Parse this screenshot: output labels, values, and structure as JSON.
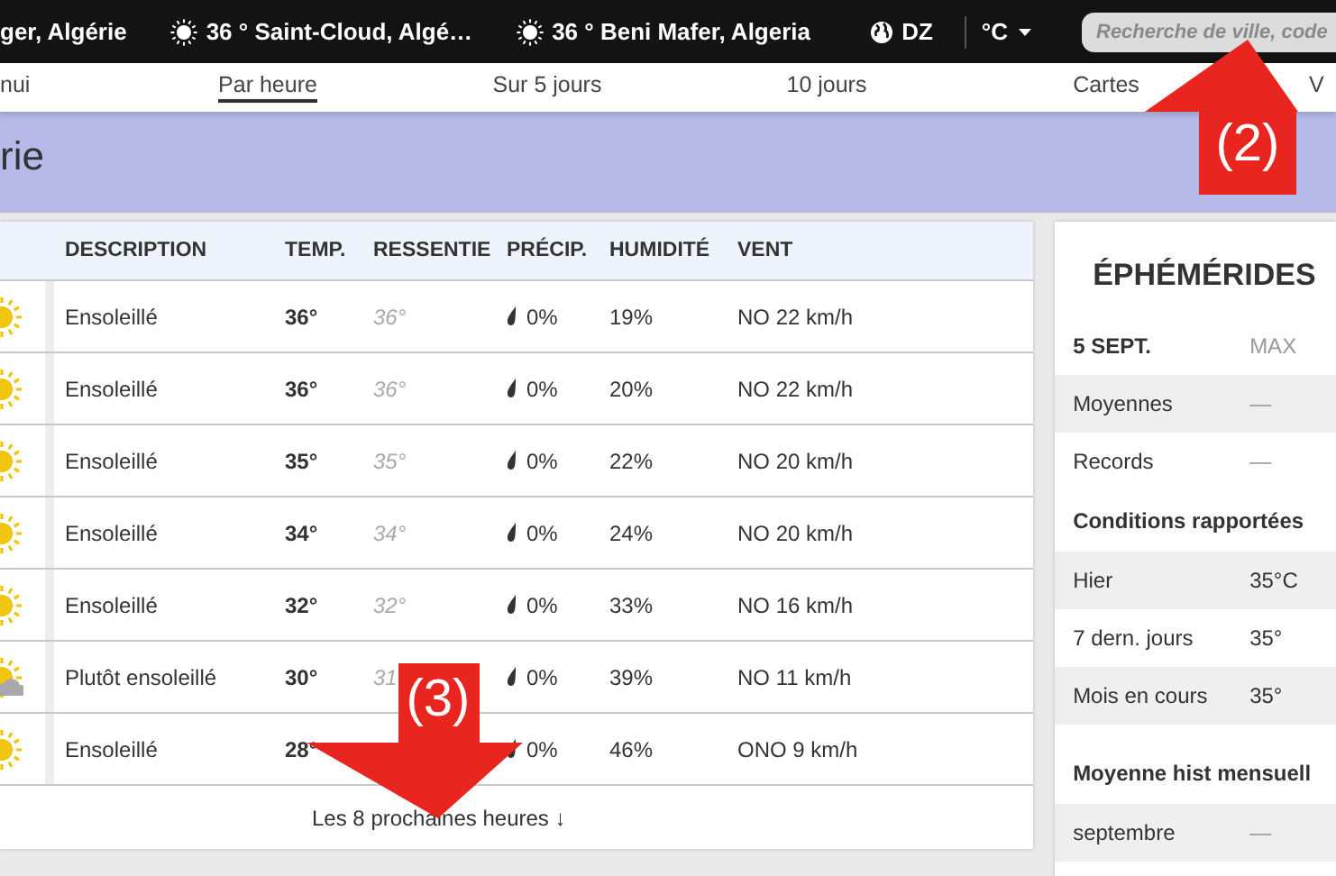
{
  "top_bar": {
    "locations": [
      {
        "kind": "plain",
        "label": "ger, Algérie"
      },
      {
        "kind": "sunny",
        "label": "36 ° Saint-Cloud, Algé…"
      },
      {
        "kind": "sunny",
        "label": "36 ° Beni Mafer, Algeria"
      }
    ],
    "country": "DZ",
    "unit": "°C",
    "search": {
      "placeholder": "Recherche de ville, code"
    }
  },
  "nav_tabs": [
    {
      "label": "nui",
      "selected": false
    },
    {
      "label": "Par heure",
      "selected": true
    },
    {
      "label": "Sur 5 jours",
      "selected": false
    },
    {
      "label": "10 jours",
      "selected": false
    },
    {
      "label": "Cartes",
      "selected": false
    },
    {
      "label": "V",
      "selected": false
    }
  ],
  "banner": {
    "title": "rie"
  },
  "hourly": {
    "columns": [
      "DESCRIPTION",
      "TEMP.",
      "RESSENTIE",
      "PRÉCIP.",
      "HUMIDITÉ",
      "VENT"
    ],
    "rows": [
      {
        "kind": "sunny",
        "description": "Ensoleillé",
        "temp": "36°",
        "feels_like": "36°",
        "precip": "0%",
        "humidity": "19%",
        "wind": "NO 22 km/h"
      },
      {
        "kind": "sunny",
        "description": "Ensoleillé",
        "temp": "36°",
        "feels_like": "36°",
        "precip": "0%",
        "humidity": "20%",
        "wind": "NO 22 km/h"
      },
      {
        "kind": "sunny",
        "description": "Ensoleillé",
        "temp": "35°",
        "feels_like": "35°",
        "precip": "0%",
        "humidity": "22%",
        "wind": "NO 20 km/h"
      },
      {
        "kind": "sunny",
        "description": "Ensoleillé",
        "temp": "34°",
        "feels_like": "34°",
        "precip": "0%",
        "humidity": "24%",
        "wind": "NO 20 km/h"
      },
      {
        "kind": "sunny",
        "description": "Ensoleillé",
        "temp": "32°",
        "feels_like": "32°",
        "precip": "0%",
        "humidity": "33%",
        "wind": "NO 16 km/h"
      },
      {
        "kind": "partly_sunny",
        "description": "Plutôt ensoleillé",
        "temp": "30°",
        "feels_like": "31",
        "precip": "0%",
        "humidity": "39%",
        "wind": "NO 11 km/h"
      },
      {
        "kind": "sunny",
        "description": "Ensoleillé",
        "temp": "28°",
        "precip": "0%",
        "humidity": "46%",
        "wind": "ONO 9 km/h"
      }
    ],
    "footer": "Les 8 prochaines heures ↓"
  },
  "ephemerides": {
    "title": "ÉPHÉMÉRIDES",
    "sections": [
      {
        "heading": "5 SEPT.",
        "heading_value": "MAX",
        "rows": [
          {
            "label": "Moyennes",
            "value": "—"
          },
          {
            "label": "Records",
            "value": "—"
          }
        ]
      },
      {
        "heading": "Conditions rapportées",
        "rows": [
          {
            "label": "Hier",
            "value": "35°C"
          },
          {
            "label": "7 dern. jours",
            "value": "35°"
          },
          {
            "label": "Mois en cours",
            "value": "35°"
          }
        ]
      },
      {
        "heading": "Moyenne hist mensuell",
        "rows": [
          {
            "label": "septembre",
            "value": "—"
          }
        ]
      }
    ]
  },
  "annotations": [
    {
      "kind": "up",
      "label": "(2)"
    },
    {
      "kind": "down",
      "label": "(3)"
    }
  ]
}
